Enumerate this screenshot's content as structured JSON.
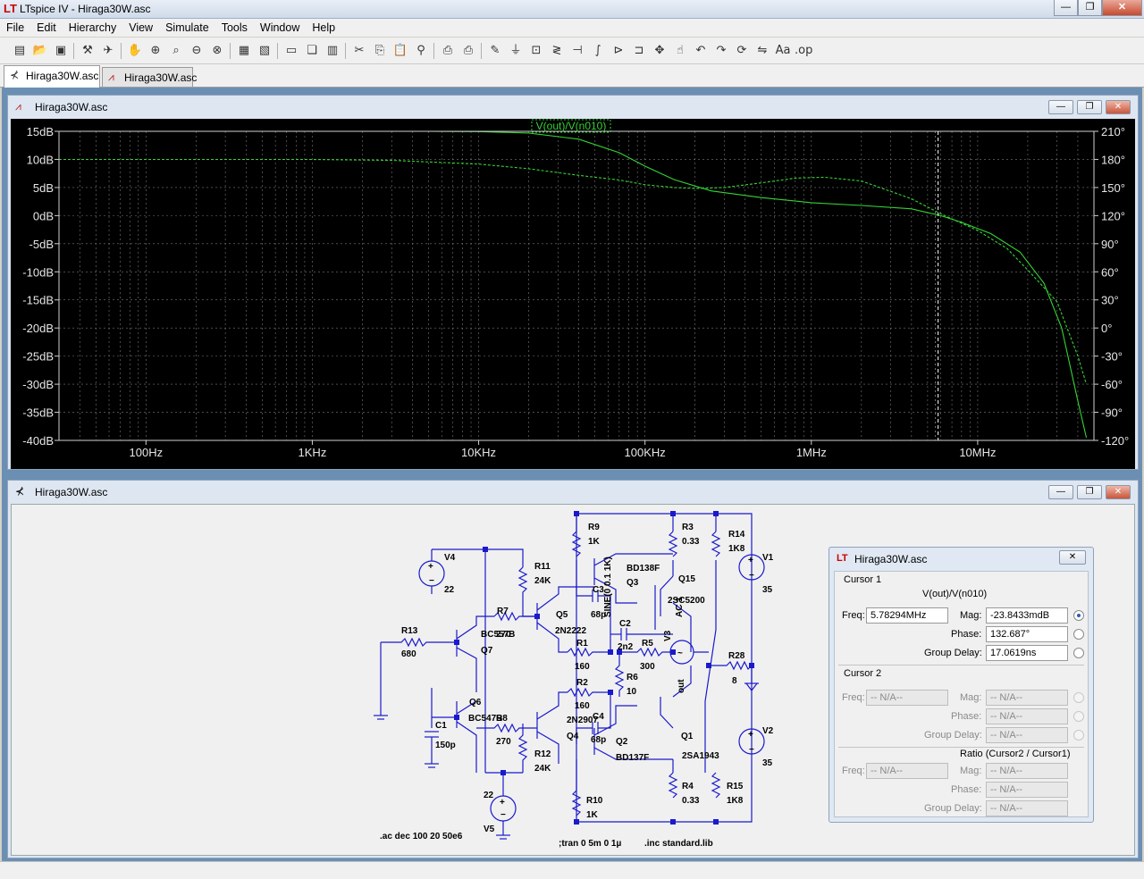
{
  "app": {
    "title": "LTspice IV - Hiraga30W.asc"
  },
  "menu": [
    "File",
    "Edit",
    "Hierarchy",
    "View",
    "Simulate",
    "Tools",
    "Window",
    "Help"
  ],
  "toolbar_icons": [
    "new-schematic-icon",
    "open-icon",
    "save-icon",
    "control-panel-icon",
    "run-icon",
    "halt-icon",
    "zoom-in-icon",
    "zoom-pan-icon",
    "zoom-out-icon",
    "zoom-fit-icon",
    "autoscale-icon",
    "grid-icon",
    "tile-horizontal-icon",
    "cascade-icon",
    "tile-vertical-icon",
    "cut-icon",
    "copy-icon",
    "paste-icon",
    "find-icon",
    "print-setup-icon",
    "print-icon",
    "wire-icon",
    "ground-icon",
    "label-icon",
    "resistor-icon",
    "capacitor-icon",
    "inductor-icon",
    "diode-icon",
    "component-icon",
    "move-icon",
    "drag-icon",
    "undo-icon",
    "redo-icon",
    "rotate-icon",
    "mirror-icon",
    "text-icon",
    "spice-directive-icon"
  ],
  "tabs": [
    {
      "label": "Hiraga30W.asc",
      "active": true,
      "icon": "schematic-tab-icon"
    },
    {
      "label": "Hiraga30W.asc",
      "active": false,
      "icon": "waveform-tab-icon"
    }
  ],
  "plot_window": {
    "title": "Hiraga30W.asc"
  },
  "schematic_window": {
    "title": "Hiraga30W.asc"
  },
  "chart_data": {
    "type": "line",
    "trace_label": "V(out)/V(n010)",
    "x_scale": "log",
    "xlim": [
      30,
      50000000
    ],
    "x_ticks": [
      100,
      1000,
      10000,
      100000,
      1000000,
      10000000
    ],
    "x_tick_labels": [
      "100Hz",
      "1KHz",
      "10KHz",
      "100KHz",
      "1MHz",
      "10MHz"
    ],
    "y_ticks": [
      15,
      10,
      5,
      0,
      -5,
      -10,
      -15,
      -20,
      -25,
      -30,
      -35,
      -40
    ],
    "y_tick_labels": [
      "15dB",
      "10dB",
      "5dB",
      "0dB",
      "-5dB",
      "-10dB",
      "-15dB",
      "-20dB",
      "-25dB",
      "-30dB",
      "-35dB",
      "-40dB"
    ],
    "ylim": [
      -40,
      15
    ],
    "y2_ticks": [
      210,
      180,
      150,
      120,
      90,
      60,
      30,
      0,
      -30,
      -60,
      -90,
      -120
    ],
    "y2_tick_labels": [
      "210°",
      "180°",
      "150°",
      "120°",
      "90°",
      "60°",
      "30°",
      "0°",
      "-30°",
      "-60°",
      "-90°",
      "-120°"
    ],
    "y2lim": [
      -120,
      210
    ],
    "grid": true,
    "cursor_x": 5782940,
    "color": "#35d435",
    "series": [
      {
        "name": "V(out)/V(n010)",
        "style": "solid",
        "x": [
          30,
          1000,
          5000,
          10000,
          20000,
          40000,
          70000,
          100000,
          150000,
          250000,
          500000,
          1000000,
          2000000,
          4000000,
          6000000,
          8000000,
          12000000,
          18000000,
          25000000,
          32000000,
          40000000,
          45000000
        ],
        "y": [
          15,
          15,
          15,
          14.95,
          14.7,
          13.6,
          11.2,
          8.8,
          6.4,
          4.4,
          3.2,
          2.3,
          1.8,
          1.2,
          0,
          -1.2,
          -3.2,
          -6.5,
          -12,
          -20,
          -33,
          -39.5
        ]
      },
      {
        "name": "phase",
        "style": "dashed",
        "x": [
          30,
          1000,
          3000,
          10000,
          20000,
          40000,
          70000,
          100000,
          150000,
          200000,
          300000,
          500000,
          800000,
          1200000,
          2000000,
          4000000,
          6000000,
          10000000,
          15000000,
          20000000,
          30000000,
          40000000,
          45000000
        ],
        "y": [
          180,
          180,
          179,
          175,
          170,
          163,
          158,
          153,
          150,
          149,
          150,
          155,
          160,
          161,
          157,
          138,
          122,
          104,
          85,
          62,
          28,
          -30,
          -60
        ]
      }
    ]
  },
  "schematic": {
    "labels": {
      "r9": "R9",
      "r9v": "1K",
      "r3": "R3",
      "r3v": "0.33",
      "r14": "R14",
      "r14v": "1K8",
      "v4": "V4",
      "v4v": "22",
      "r11": "R11",
      "r11v": "24K",
      "bd138": "BD138F",
      "q15": "Q15",
      "q3": "Q3",
      "c3": "C3",
      "c3v": "68p",
      "q15t": "2SC5200",
      "sine": "SINE(0 0.1 1K)",
      "ac": "AC 1",
      "v1": "V1",
      "v1v": "35",
      "r7": "R7",
      "bc": "BC557B",
      "r7v": "270",
      "q5": "Q5",
      "q5t": "2N2222",
      "c2": "C2",
      "c2v": "2n2",
      "r13": "R13",
      "r13v": "680",
      "q7": "Q7",
      "r1": "R1",
      "r1v": "160",
      "r5": "R5",
      "r5v": "300",
      "r28": "R28",
      "r28v": "8",
      "r6": "R6",
      "r6v": "10",
      "out": "out",
      "r2": "R2",
      "r2v": "160",
      "q6": "Q6",
      "c1": "C1",
      "c1v": "150p",
      "bc547": "BC547B",
      "r8v": "270",
      "r8": "R8",
      "q4t": "2N2907",
      "c4": "C4",
      "q4": "Q4",
      "c4v": "68p",
      "q2": "Q2",
      "q1": "Q1",
      "v2": "V2",
      "v2v": "35",
      "r12": "R12",
      "r12v": "24K",
      "bd137": "BD137F",
      "q1t": "2SA1943",
      "v5v": "22",
      "r4": "R4",
      "r4v": "0.33",
      "r15": "R15",
      "r15v": "1K8",
      "r10": "R10",
      "r10v": "1K",
      "v5": "V5",
      "v3": "V3",
      "dir_ac": ".ac dec 100 20 50e6",
      "dir_tran": ";tran 0 5m 0 1µ",
      "dir_inc": ".inc standard.lib"
    }
  },
  "cursor_dialog": {
    "title": "Hiraga30W.asc",
    "cursor1": {
      "group": "Cursor 1",
      "trace": "V(out)/V(n010)",
      "freq_label": "Freq:",
      "freq": "5.78294MHz",
      "mag_label": "Mag:",
      "mag": "-23.8433mdB",
      "phase_label": "Phase:",
      "phase": "132.687°",
      "gd_label": "Group Delay:",
      "gd": "17.0619ns"
    },
    "cursor2": {
      "group": "Cursor 2",
      "freq_label": "Freq:",
      "freq": "-- N/A--",
      "mag_label": "Mag:",
      "mag": "-- N/A--",
      "phase_label": "Phase:",
      "phase": "-- N/A--",
      "gd_label": "Group Delay:",
      "gd": "-- N/A--"
    },
    "ratio": {
      "group": "Ratio (Cursor2 / Cursor1)",
      "freq_label": "Freq:",
      "freq": "-- N/A--",
      "mag_label": "Mag:",
      "mag": "-- N/A--",
      "phase_label": "Phase:",
      "phase": "-- N/A--",
      "gd_label": "Group Delay:",
      "gd": "-- N/A--"
    }
  }
}
